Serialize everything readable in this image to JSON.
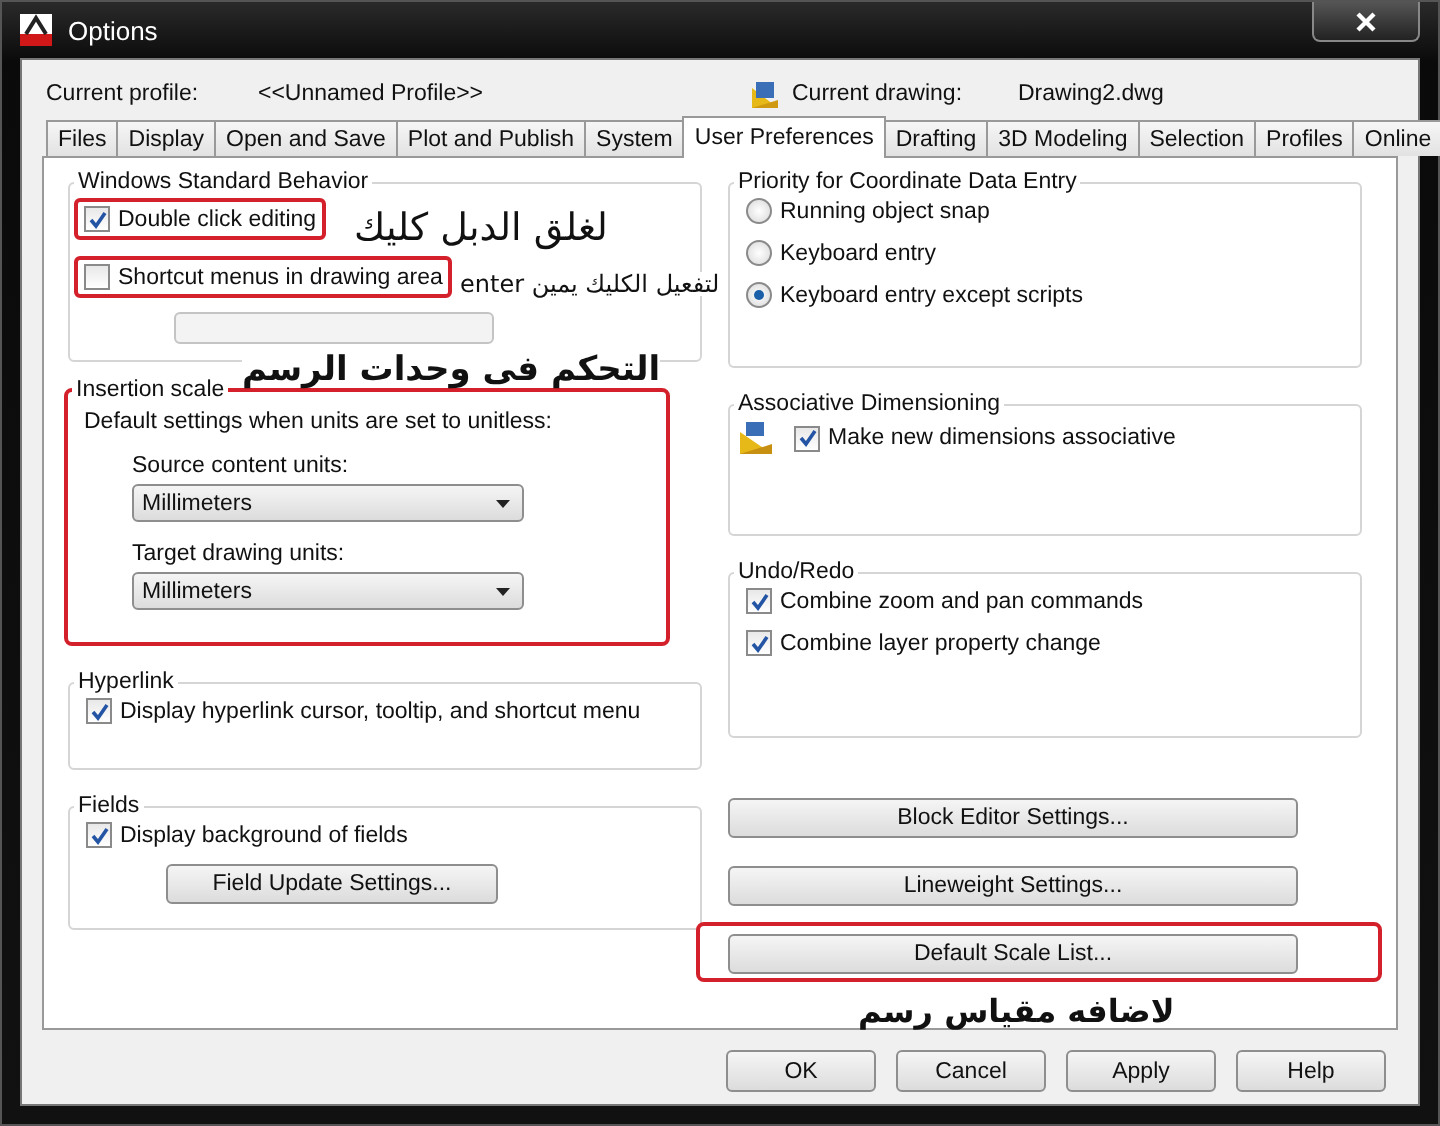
{
  "window": {
    "title": "Options"
  },
  "profile": {
    "label": "Current profile:",
    "value": "<<Unnamed Profile>>"
  },
  "drawing": {
    "label": "Current drawing:",
    "value": "Drawing2.dwg"
  },
  "tabs": [
    {
      "label": "Files",
      "selected": false
    },
    {
      "label": "Display",
      "selected": false
    },
    {
      "label": "Open and Save",
      "selected": false
    },
    {
      "label": "Plot and Publish",
      "selected": false
    },
    {
      "label": "System",
      "selected": false
    },
    {
      "label": "User Preferences",
      "selected": true
    },
    {
      "label": "Drafting",
      "selected": false
    },
    {
      "label": "3D Modeling",
      "selected": false
    },
    {
      "label": "Selection",
      "selected": false
    },
    {
      "label": "Profiles",
      "selected": false
    },
    {
      "label": "Online",
      "selected": false
    }
  ],
  "left_groups": [
    {
      "title": "Windows Standard Behavior",
      "highlighted": false,
      "items": [
        {
          "kind": "checkbox",
          "label": "Double click editing",
          "checked": true,
          "highlighted": true
        },
        {
          "kind": "checkbox",
          "label": "Shortcut menus in drawing area",
          "checked": false,
          "highlighted": true
        },
        {
          "kind": "blank_button",
          "disabled": true
        }
      ]
    },
    {
      "title": "Insertion scale",
      "highlighted": true,
      "items": [
        {
          "kind": "text",
          "label": "Default settings when units are set to unitless:"
        },
        {
          "kind": "dropdown",
          "label": "Source content units:",
          "value": "Millimeters"
        },
        {
          "kind": "dropdown",
          "label": "Target drawing units:",
          "value": "Millimeters"
        }
      ]
    },
    {
      "title": "Hyperlink",
      "highlighted": false,
      "items": [
        {
          "kind": "checkbox",
          "label": "Display hyperlink cursor, tooltip, and shortcut menu",
          "checked": true,
          "highlighted": false
        }
      ]
    },
    {
      "title": "Fields",
      "highlighted": false,
      "items": [
        {
          "kind": "checkbox",
          "label": "Display background of fields",
          "checked": true,
          "highlighted": false
        },
        {
          "kind": "button",
          "label": "Field Update Settings..."
        }
      ]
    }
  ],
  "right_groups": [
    {
      "title": "Priority for Coordinate Data Entry",
      "highlighted": false,
      "items": [
        {
          "kind": "radio",
          "label": "Running object snap",
          "selected": false
        },
        {
          "kind": "radio",
          "label": "Keyboard entry",
          "selected": false
        },
        {
          "kind": "radio",
          "label": "Keyboard entry except scripts",
          "selected": true
        }
      ]
    },
    {
      "title": "Associative Dimensioning",
      "highlighted": false,
      "items": [
        {
          "kind": "icon_checkbox",
          "label": "Make new dimensions associative",
          "checked": true,
          "highlighted": false
        }
      ]
    },
    {
      "title": "Undo/Redo",
      "highlighted": false,
      "items": [
        {
          "kind": "checkbox",
          "label": "Combine zoom and pan commands",
          "checked": true,
          "highlighted": false
        },
        {
          "kind": "checkbox",
          "label": "Combine layer property change",
          "checked": true,
          "highlighted": false
        }
      ]
    }
  ],
  "right_buttons": [
    {
      "label": "Block Editor Settings...",
      "highlighted": false
    },
    {
      "label": "Lineweight Settings...",
      "highlighted": false
    },
    {
      "label": "Default Scale List...",
      "highlighted": true
    }
  ],
  "buttons": [
    "OK",
    "Cancel",
    "Apply",
    "Help"
  ],
  "annotations": [
    {
      "text": "لغلق الدبل كليك"
    },
    {
      "text": "لتفعيل الكليك يمين enter"
    },
    {
      "text": "التحكم فى وحدات الرسم"
    },
    {
      "text": "لاضافه مقياس رسم"
    }
  ]
}
